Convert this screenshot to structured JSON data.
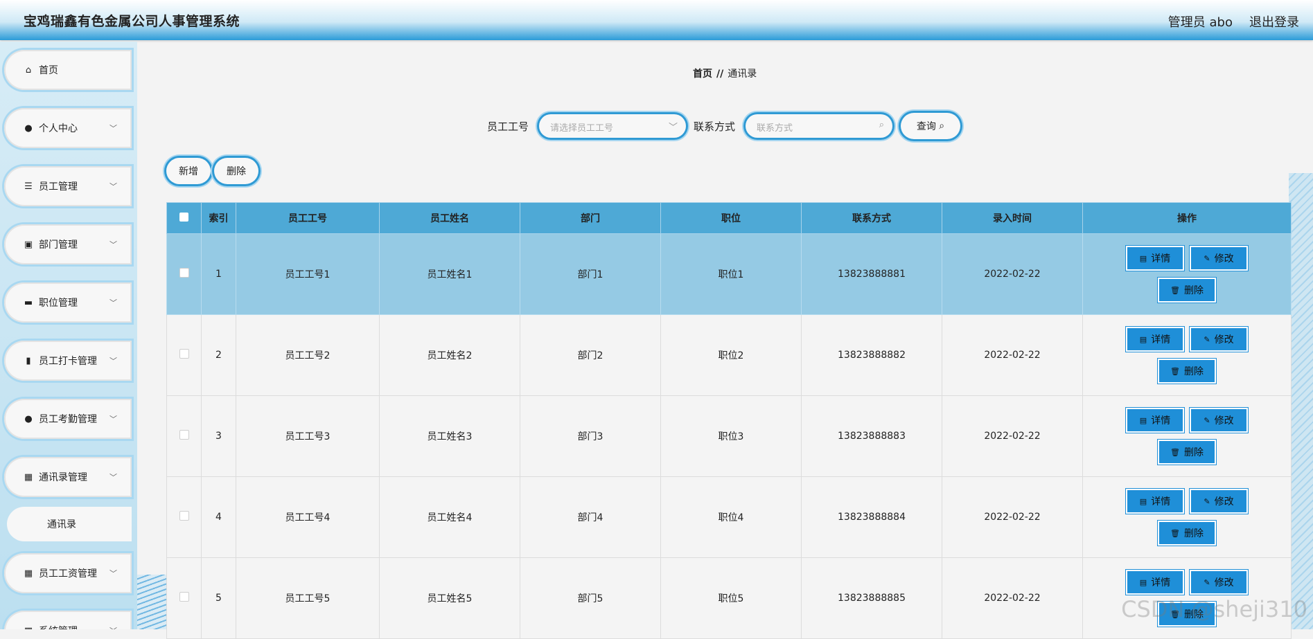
{
  "header": {
    "title": "宝鸡瑞鑫有色金属公司人事管理系统",
    "admin": "管理员 abo",
    "logout": "退出登录"
  },
  "sidebar": {
    "items": [
      {
        "label": "首页",
        "icon": "home-icon",
        "glyph": "⌂"
      },
      {
        "label": "个人中心",
        "icon": "user-icon",
        "glyph": "●"
      },
      {
        "label": "员工管理",
        "icon": "list-icon",
        "glyph": "☰"
      },
      {
        "label": "部门管理",
        "icon": "clipboard-icon",
        "glyph": "▣"
      },
      {
        "label": "职位管理",
        "icon": "ticket-icon",
        "glyph": "▬"
      },
      {
        "label": "员工打卡管理",
        "icon": "bar-chart-icon",
        "glyph": "▮"
      },
      {
        "label": "员工考勤管理",
        "icon": "user-icon",
        "glyph": "●"
      },
      {
        "label": "通讯录管理",
        "icon": "grid-icon",
        "glyph": "▦"
      },
      {
        "label": "员工工资管理",
        "icon": "grid-icon",
        "glyph": "▦"
      },
      {
        "label": "系统管理",
        "icon": "grid-icon",
        "glyph": "▦"
      }
    ],
    "sub_item": "通讯录"
  },
  "breadcrumb": {
    "home": "首页",
    "sep": "//",
    "current": "通讯录"
  },
  "search": {
    "emp_label": "员工工号",
    "emp_placeholder": "请选择员工工号",
    "contact_label": "联系方式",
    "contact_placeholder": "联系方式",
    "query": "查询"
  },
  "actions": {
    "add": "新增",
    "delete": "删除"
  },
  "table": {
    "headers": [
      "索引",
      "员工工号",
      "员工姓名",
      "部门",
      "职位",
      "联系方式",
      "录入时间",
      "操作"
    ],
    "ops": {
      "detail": "详情",
      "edit": "修改",
      "delete": "删除"
    },
    "rows": [
      {
        "index": "1",
        "emp_no": "员工工号1",
        "name": "员工姓名1",
        "dept": "部门1",
        "pos": "职位1",
        "phone": "13823888881",
        "date": "2022-02-22"
      },
      {
        "index": "2",
        "emp_no": "员工工号2",
        "name": "员工姓名2",
        "dept": "部门2",
        "pos": "职位2",
        "phone": "13823888882",
        "date": "2022-02-22"
      },
      {
        "index": "3",
        "emp_no": "员工工号3",
        "name": "员工姓名3",
        "dept": "部门3",
        "pos": "职位3",
        "phone": "13823888883",
        "date": "2022-02-22"
      },
      {
        "index": "4",
        "emp_no": "员工工号4",
        "name": "员工姓名4",
        "dept": "部门4",
        "pos": "职位4",
        "phone": "13823888884",
        "date": "2022-02-22"
      },
      {
        "index": "5",
        "emp_no": "员工工号5",
        "name": "员工姓名5",
        "dept": "部门5",
        "pos": "职位5",
        "phone": "13823888885",
        "date": "2022-02-22"
      }
    ]
  },
  "watermark": "CSDN @sheji310",
  "colors": {
    "accent": "#2f9ad4",
    "header_row": "#4ea9d6",
    "selected_row": "#95cae4",
    "op_button": "#1f8fd8"
  }
}
